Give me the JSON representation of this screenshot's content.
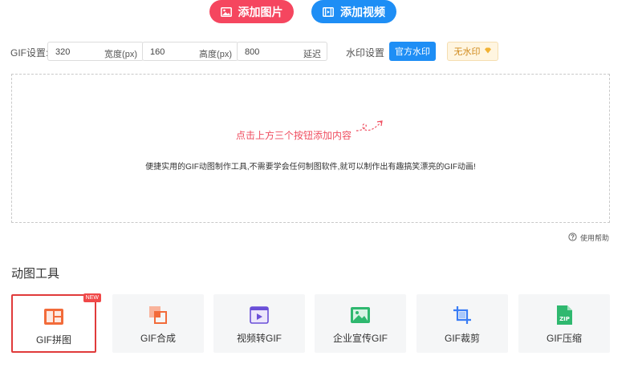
{
  "top_buttons": {
    "add_image": "添加图片",
    "add_video": "添加视频"
  },
  "gif_settings": {
    "label": "GIF设置:",
    "width": {
      "value": "320",
      "unit": "宽度(px)"
    },
    "height": {
      "value": "160",
      "unit": "高度(px)"
    },
    "delay": {
      "value": "800",
      "unit": "延迟"
    }
  },
  "watermark": {
    "label": "水印设置",
    "official": "官方水印",
    "none": "无水印"
  },
  "dropzone": {
    "hint": "点击上方三个按钮添加内容",
    "description": "便捷实用的GIF动图制作工具,不需要学会任何制图软件,就可以制作出有趣搞笑漂亮的GIF动画!"
  },
  "help": "使用帮助",
  "tools_section": {
    "title": "动图工具",
    "items": [
      {
        "label": "GIF拼图",
        "badge": "NEW",
        "icon": "collage-icon",
        "active": true
      },
      {
        "label": "GIF合成",
        "icon": "merge-icon"
      },
      {
        "label": "视频转GIF",
        "icon": "video-to-gif-icon"
      },
      {
        "label": "企业宣传GIF",
        "icon": "image-icon"
      },
      {
        "label": "GIF裁剪",
        "icon": "crop-icon"
      },
      {
        "label": "GIF压缩",
        "icon": "zip-icon"
      }
    ]
  },
  "colors": {
    "primary_blue": "#1e8ef5",
    "primary_red": "#f5465f",
    "hint_red": "#ef4d5f",
    "active_border": "#e03b3b"
  }
}
